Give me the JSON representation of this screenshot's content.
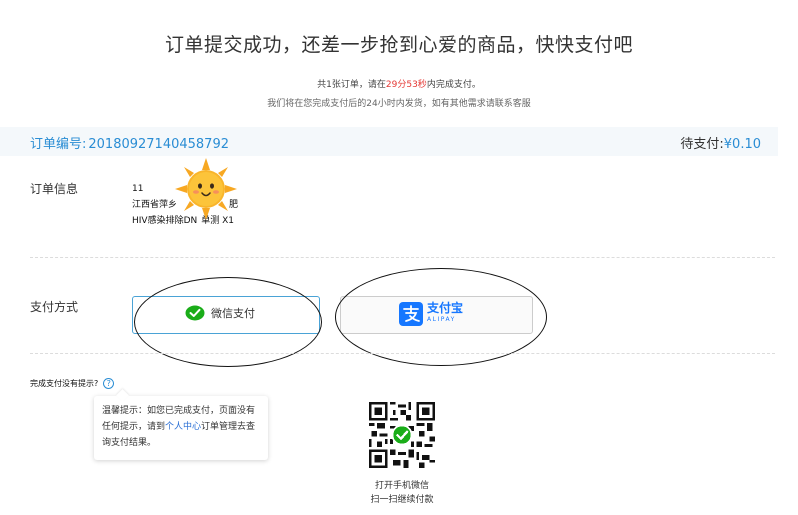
{
  "header": {
    "title": "订单提交成功，还差一步抢到心爱的商品，快快支付吧",
    "countdown_prefix": "共1张订单，请在",
    "countdown_time": "29分53秒",
    "countdown_suffix": "内完成支付。",
    "shipping_notice": "我们将在您完成支付后的24小时内发货，如有其他需求请联系客服"
  },
  "order": {
    "number_label": "订单编号:",
    "number": "20180927140458792",
    "amount_label": "待支付:",
    "amount": "¥0.10"
  },
  "order_info": {
    "label": "订单信息",
    "line1": "11",
    "line2": "江西省萍乡",
    "line2_tail": "肥",
    "line3": "HIV感染排除DN",
    "line3_tail": "单测 X1"
  },
  "payment": {
    "label": "支付方式",
    "wechat_label": "微信支付",
    "alipay_label": "支付宝",
    "alipay_sub": "ALIPAY"
  },
  "hint": {
    "title": "完成支付没有提示?",
    "help_icon": "?",
    "tip_prefix": "温馨提示：如您已完成支付，页面没有任何提示，请到",
    "tip_link": "个人中心",
    "tip_suffix": "订单管理去查询支付结果。"
  },
  "qr": {
    "caption_line1": "打开手机微信",
    "caption_line2": "扫一扫继续付款"
  },
  "colors": {
    "accent_blue": "#2a8dd4",
    "countdown_red": "#e53935",
    "wechat_green": "#1aad19",
    "alipay_blue": "#1677ff"
  }
}
